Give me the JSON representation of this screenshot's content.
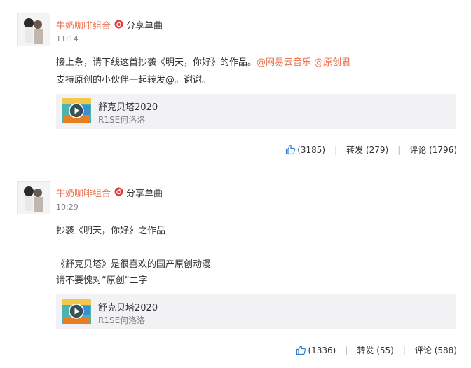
{
  "posts": [
    {
      "author": "牛奶咖啡组合",
      "source": "分享单曲",
      "time": "11:14",
      "lines": [
        {
          "text": "接上条，请下线这首抄袭《明天，你好》的作品。",
          "mentions": [
            "@网易云音乐",
            "@原创君"
          ]
        },
        {
          "text": "支持原创的小伙伴一起转发@。谢谢。"
        }
      ],
      "song": {
        "title": "舒克贝塔2020",
        "artist": "R1SE何洛洛"
      },
      "likes": "(3185)",
      "repost_label": "转发 (279)",
      "comment_label": "评论 (1796)"
    },
    {
      "author": "牛奶咖啡组合",
      "source": "分享单曲",
      "time": "10:29",
      "lines": [
        {
          "text": "抄袭《明天，你好》之作品"
        },
        {
          "text": "《舒克贝塔》是很喜欢的国产原创动漫"
        },
        {
          "text": "请不要愧对“原创”二字"
        }
      ],
      "song": {
        "title": "舒克贝塔2020",
        "artist": "R1SE何洛洛"
      },
      "likes": "(1336)",
      "repost_label": "转发 (55)",
      "comment_label": "评论 (588)"
    }
  ],
  "icons": {
    "like": "thumbs-up-icon",
    "source": "netease-music-icon",
    "play": "play-icon"
  },
  "colors": {
    "accent": "#eb7350",
    "time": "#808080",
    "card_bg": "#f2f2f5",
    "like_icon": "#2f7dd1"
  }
}
